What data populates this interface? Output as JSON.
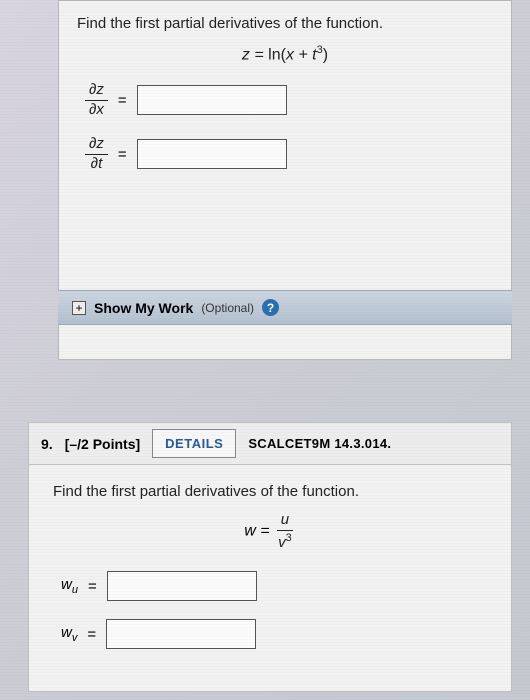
{
  "q1": {
    "prompt": "Find the first partial derivatives of the function.",
    "equation": {
      "lhs": "z",
      "eq": " = ",
      "fn": "ln(",
      "var1": "x",
      "plus": " + ",
      "var2": "t",
      "exp": "3",
      "close": ")"
    },
    "rows": [
      {
        "num": "∂z",
        "den": "∂x",
        "eq": "="
      },
      {
        "num": "∂z",
        "den": "∂t",
        "eq": "="
      }
    ],
    "smw": {
      "plus": "+",
      "label": "Show My Work",
      "opt": "(Optional)",
      "help": "?"
    }
  },
  "q2": {
    "number": "9.",
    "points": "[–/2 Points]",
    "details": "DETAILS",
    "source": "SCALCET9M 14.3.014.",
    "prompt": "Find the first partial derivatives of the function.",
    "equation": {
      "lhs": "w",
      "eq": " = ",
      "num": "u",
      "den_base": "v",
      "den_exp": "3"
    },
    "rows": [
      {
        "base": "w",
        "sub": "u",
        "eq": " = "
      },
      {
        "base": "w",
        "sub": "v",
        "eq": " = "
      }
    ]
  }
}
